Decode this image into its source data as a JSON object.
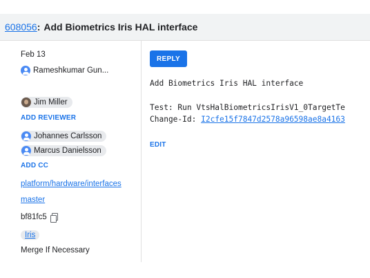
{
  "header": {
    "change_number": "608056",
    "separator": ":",
    "title": "Add Biometrics Iris HAL interface"
  },
  "sidebar": {
    "date": "Feb 13",
    "owner": "Rameshkumar Gun...",
    "reviewer": "Jim Miller",
    "add_reviewer": "ADD REVIEWER",
    "cc": [
      "Johannes Carlsson",
      "Marcus Danielsson"
    ],
    "add_cc": "ADD CC",
    "repo": "platform/hardware/interfaces",
    "branch": "master",
    "commit": "bf81fc5",
    "topic": "Iris",
    "strategy": "Merge If Necessary"
  },
  "message": {
    "reply_label": "REPLY",
    "subject": "Add Biometrics Iris HAL interface",
    "test_line": "Test: Run VtsHalBiometricsIrisV1_0TargetTe",
    "change_id_label": "Change-Id: ",
    "change_id": "I2cfe15f7847d2578a96598ae8a4163",
    "edit_label": "EDIT"
  }
}
